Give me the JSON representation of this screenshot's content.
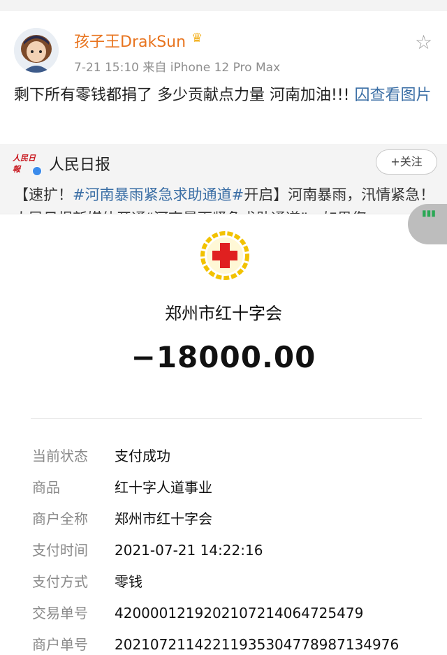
{
  "post": {
    "username": "孩子王DrakSun",
    "crown_icon": "crown-icon",
    "meta": "7-21 15:10  来自 iPhone 12 Pro Max",
    "text_main": "剩下所有零钱都捐了 多少贡献点力量 河南加油!!! ",
    "text_link": "囚查看图片"
  },
  "repost": {
    "account_logo": "人民日報",
    "account_name": "人民日报",
    "follow_label": "+关注",
    "text_prefix": "【速扩！",
    "text_tag": "#河南暴雨紧急求助通道#",
    "text_suffix": "开启】河南暴雨，汛情紧急！人民日报新媒体开通“河南暴雨紧急求助通道”，如果您"
  },
  "receipt": {
    "org_name": "郑州市红十字会",
    "amount": "−18000.00",
    "emblem_color": "#e02020",
    "emblem_wreath_color": "#f2c200",
    "details": [
      {
        "label": "当前状态",
        "value": "支付成功"
      },
      {
        "label": "商品",
        "value": "红十字人道事业"
      },
      {
        "label": "商户全称",
        "value": "郑州市红十字会"
      },
      {
        "label": "支付时间",
        "value": "2021-07-21 14:22:16"
      },
      {
        "label": "支付方式",
        "value": "零钱"
      },
      {
        "label": "交易单号",
        "value": "4200001219202107214064725479"
      },
      {
        "label": "商户单号",
        "value": "20210721142211935304778987134976"
      }
    ]
  }
}
